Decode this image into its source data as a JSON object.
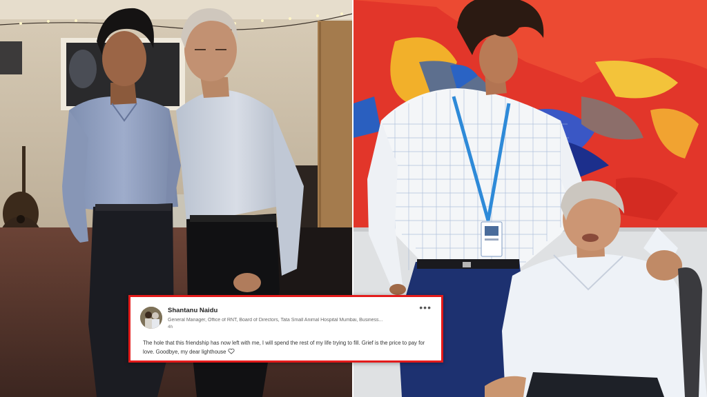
{
  "post": {
    "author": "Shantanu Naidu",
    "headline": "General Manager, Office of RNT, Board of Directors, Tata Small Animal Hospital Mumbai, Business...",
    "time": "4h",
    "body": "The hole that this friendship has now left with me, I will spend the rest of my life trying to fill. Grief is the price to pay for love. Goodbye, my dear lighthouse",
    "more_label": "•••"
  },
  "colors": {
    "highlight_border": "#e41b1b",
    "card_background": "#ffffff"
  },
  "icons": {
    "menu": "more-horizontal-icon",
    "reaction": "heart-icon"
  }
}
